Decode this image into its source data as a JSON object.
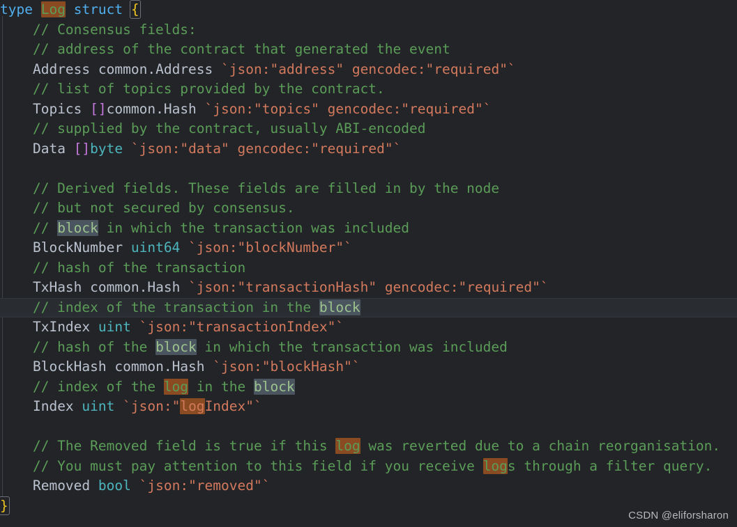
{
  "editor": {
    "language": "go",
    "background": "#222427",
    "current_line_background": "#292c31",
    "watermark": "CSDN @eliforsharon",
    "colors": {
      "keyword": "#51afef",
      "identifier": "#bbc2cf",
      "type": "#4db5bd",
      "comment": "#5b9c58",
      "struct_tag": "#d3795d",
      "bracket": "#c678dd",
      "brace": "#f0c420",
      "search_occurrence_bg": "#4a5560",
      "search_current_bg": "#8a4a22"
    }
  },
  "code": {
    "l01": {
      "t_type": "type",
      "sp1": " ",
      "t_log": "Log",
      "sp2": " ",
      "t_struct": "struct",
      "sp3": " ",
      "t_brace": "{"
    },
    "l02": {
      "comment": "    // Consensus fields:"
    },
    "l03": {
      "comment": "    // address of the contract that generated the event"
    },
    "l04": {
      "indent": "    ",
      "name": "Address",
      "sp1": " ",
      "type": "common.Address",
      "sp2": " ",
      "tag": "`json:\"address\" gencodec:\"required\"`"
    },
    "l05": {
      "comment": "    // list of topics provided by the contract."
    },
    "l06": {
      "indent": "    ",
      "name": "Topics",
      "sp1": " ",
      "bracket": "[]",
      "type": "common.Hash",
      "sp2": " ",
      "tag": "`json:\"topics\" gencodec:\"required\"`"
    },
    "l07": {
      "comment": "    // supplied by the contract, usually ABI-encoded"
    },
    "l08": {
      "indent": "    ",
      "name": "Data",
      "sp1": " ",
      "bracket": "[]",
      "type": "byte",
      "sp2": " ",
      "tag": "`json:\"data\" gencodec:\"required\"`"
    },
    "l09": {
      "blank": ""
    },
    "l10": {
      "comment": "    // Derived fields. These fields are filled in by the node"
    },
    "l11": {
      "comment": "    // but not secured by consensus."
    },
    "l12": {
      "pre": "    // ",
      "hl": "block",
      "post": " in which the transaction was included"
    },
    "l13": {
      "indent": "    ",
      "name": "BlockNumber",
      "sp1": " ",
      "type": "uint64",
      "sp2": " ",
      "tag": "`json:\"blockNumber\"`"
    },
    "l14": {
      "comment": "    // hash of the transaction"
    },
    "l15": {
      "indent": "    ",
      "name": "TxHash",
      "sp1": " ",
      "type": "common.Hash",
      "sp2": " ",
      "tag": "`json:\"transactionHash\" gencodec:\"required\"`"
    },
    "l16": {
      "pre": "    // index of the transaction in the ",
      "hl": "block",
      "post": ""
    },
    "l17": {
      "indent": "    ",
      "name": "TxIndex",
      "sp1": " ",
      "type": "uint",
      "sp2": " ",
      "tag": "`json:\"transactionIndex\"`"
    },
    "l18": {
      "pre": "    // hash of the ",
      "hl": "block",
      "post": " in which the transaction was included"
    },
    "l19": {
      "indent": "    ",
      "name": "BlockHash",
      "sp1": " ",
      "type": "common.Hash",
      "sp2": " ",
      "tag": "`json:\"blockHash\"`"
    },
    "l20": {
      "pre": "    // index of the ",
      "hl_cur": "log",
      "mid": " in the ",
      "hl_occ": "block",
      "post": ""
    },
    "l21": {
      "indent": "    ",
      "name": "Index",
      "sp1": " ",
      "type": "uint",
      "sp2": " ",
      "tag_pre": "`json:\"",
      "tag_hl": "log",
      "tag_post": "Index\"`"
    },
    "l22": {
      "blank": ""
    },
    "l23": {
      "pre": "    // The Removed field is true if this ",
      "hl_cur": "log",
      "post": " was reverted due to a chain reorganisation."
    },
    "l24": {
      "pre": "    // You must pay attention to this field if you receive ",
      "hl_cur": "log",
      "post": "s through a filter query."
    },
    "l25": {
      "indent": "    ",
      "name": "Removed",
      "sp1": " ",
      "type": "bool",
      "sp2": " ",
      "tag": "`json:\"removed\"`"
    },
    "l26": {
      "brace": "}"
    }
  }
}
